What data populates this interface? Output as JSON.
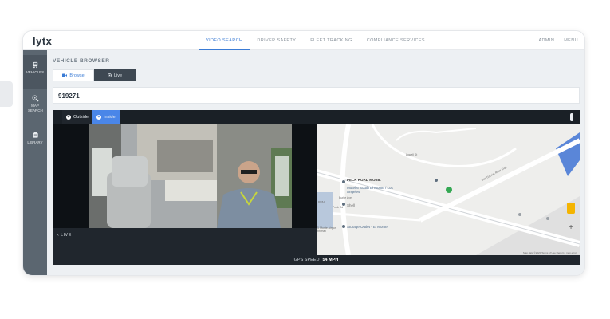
{
  "app": {
    "logo": "lytx"
  },
  "nav": {
    "items": [
      {
        "label": "VIDEO SEARCH",
        "active": true
      },
      {
        "label": "DRIVER SAFETY",
        "active": false
      },
      {
        "label": "FLEET TRACKING",
        "active": false
      },
      {
        "label": "COMPLIANCE SERVICES",
        "active": false
      }
    ],
    "admin": "ADMIN",
    "menu": "MENU"
  },
  "sidebar": {
    "items": [
      {
        "label": "VEHICLES",
        "icon": "truck-icon",
        "active": true
      },
      {
        "label": "MAP SEARCH",
        "icon": "map-search-icon",
        "active": false
      },
      {
        "label": "LIBRARY",
        "icon": "library-icon",
        "active": false
      }
    ]
  },
  "page": {
    "title": "VEHICLE BROWSER"
  },
  "mode_toggle": {
    "browse": "Browse",
    "live": "Live",
    "selected": "Live"
  },
  "search": {
    "value": "919271"
  },
  "camera": {
    "outside": "Outside",
    "inside": "Inside",
    "selected": "Inside"
  },
  "video": {
    "status": "LIVE"
  },
  "map": {
    "labels": {
      "peck_road_mobil": "PECK ROAD MOBIL",
      "motel6": "Motel 6 South El Monte / Los Angeles",
      "shell": "Shell",
      "storage_outlet": "Storage Outlet - El Monte",
      "inn": "INN",
      "burke_ave": "Burke Ave",
      "peck_rd": "Peck Rd",
      "san_gabriel_trail": "San Gabriel River Trail",
      "el_monte": "El Monte Airport Inn Hall",
      "lowell_st": "Lowell St"
    },
    "zoom_in": "+",
    "zoom_out": "−",
    "footer": "Map data ©2020  Terms of Use  Report a map error"
  },
  "gps": {
    "label": "GPS SPEED",
    "value": "54 MPH"
  },
  "colors": {
    "accent": "#4a86e8",
    "sidebar": "#5b6670",
    "dark_panel": "#20262d"
  }
}
